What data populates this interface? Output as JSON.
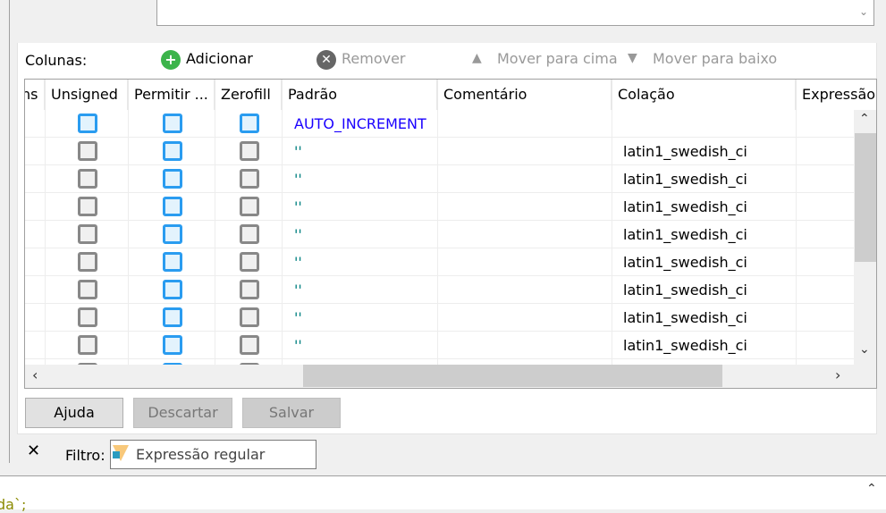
{
  "toolbar": {
    "label": "Colunas:",
    "add": "Adicionar",
    "remove": "Remover",
    "move_up": "Mover para cima",
    "move_down": "Mover para baixo"
  },
  "grid": {
    "headers": [
      "ns",
      "Unsigned",
      "Permitir ...",
      "Zerofill",
      "Padrão",
      "Comentário",
      "Colação",
      "Expressão"
    ],
    "rows": [
      {
        "unsigned": true,
        "allow_null": true,
        "zerofill": true,
        "default": "AUTO_INCREMENT",
        "comment": "",
        "collation": ""
      },
      {
        "unsigned": false,
        "allow_null": true,
        "zerofill": false,
        "default": "''",
        "comment": "",
        "collation": "latin1_swedish_ci"
      },
      {
        "unsigned": false,
        "allow_null": true,
        "zerofill": false,
        "default": "''",
        "comment": "",
        "collation": "latin1_swedish_ci"
      },
      {
        "unsigned": false,
        "allow_null": true,
        "zerofill": false,
        "default": "''",
        "comment": "",
        "collation": "latin1_swedish_ci"
      },
      {
        "unsigned": false,
        "allow_null": true,
        "zerofill": false,
        "default": "''",
        "comment": "",
        "collation": "latin1_swedish_ci"
      },
      {
        "unsigned": false,
        "allow_null": true,
        "zerofill": false,
        "default": "''",
        "comment": "",
        "collation": "latin1_swedish_ci"
      },
      {
        "unsigned": false,
        "allow_null": true,
        "zerofill": false,
        "default": "''",
        "comment": "",
        "collation": "latin1_swedish_ci"
      },
      {
        "unsigned": false,
        "allow_null": true,
        "zerofill": false,
        "default": "''",
        "comment": "",
        "collation": "latin1_swedish_ci"
      },
      {
        "unsigned": false,
        "allow_null": true,
        "zerofill": false,
        "default": "''",
        "comment": "",
        "collation": "latin1_swedish_ci"
      },
      {
        "unsigned": false,
        "allow_null": true,
        "zerofill": false,
        "default": "",
        "comment": "",
        "collation": ""
      }
    ]
  },
  "buttons": {
    "help": "Ajuda",
    "discard": "Descartar",
    "save": "Salvar"
  },
  "filter": {
    "label": "Filtro:",
    "placeholder": "Expressão regular"
  },
  "editor": {
    "text": "da`;"
  },
  "colors": {
    "accent": "#2a9cf0",
    "add": "#3cb44b",
    "default_keyword": "#1a00ff",
    "default_string": "#008080"
  }
}
